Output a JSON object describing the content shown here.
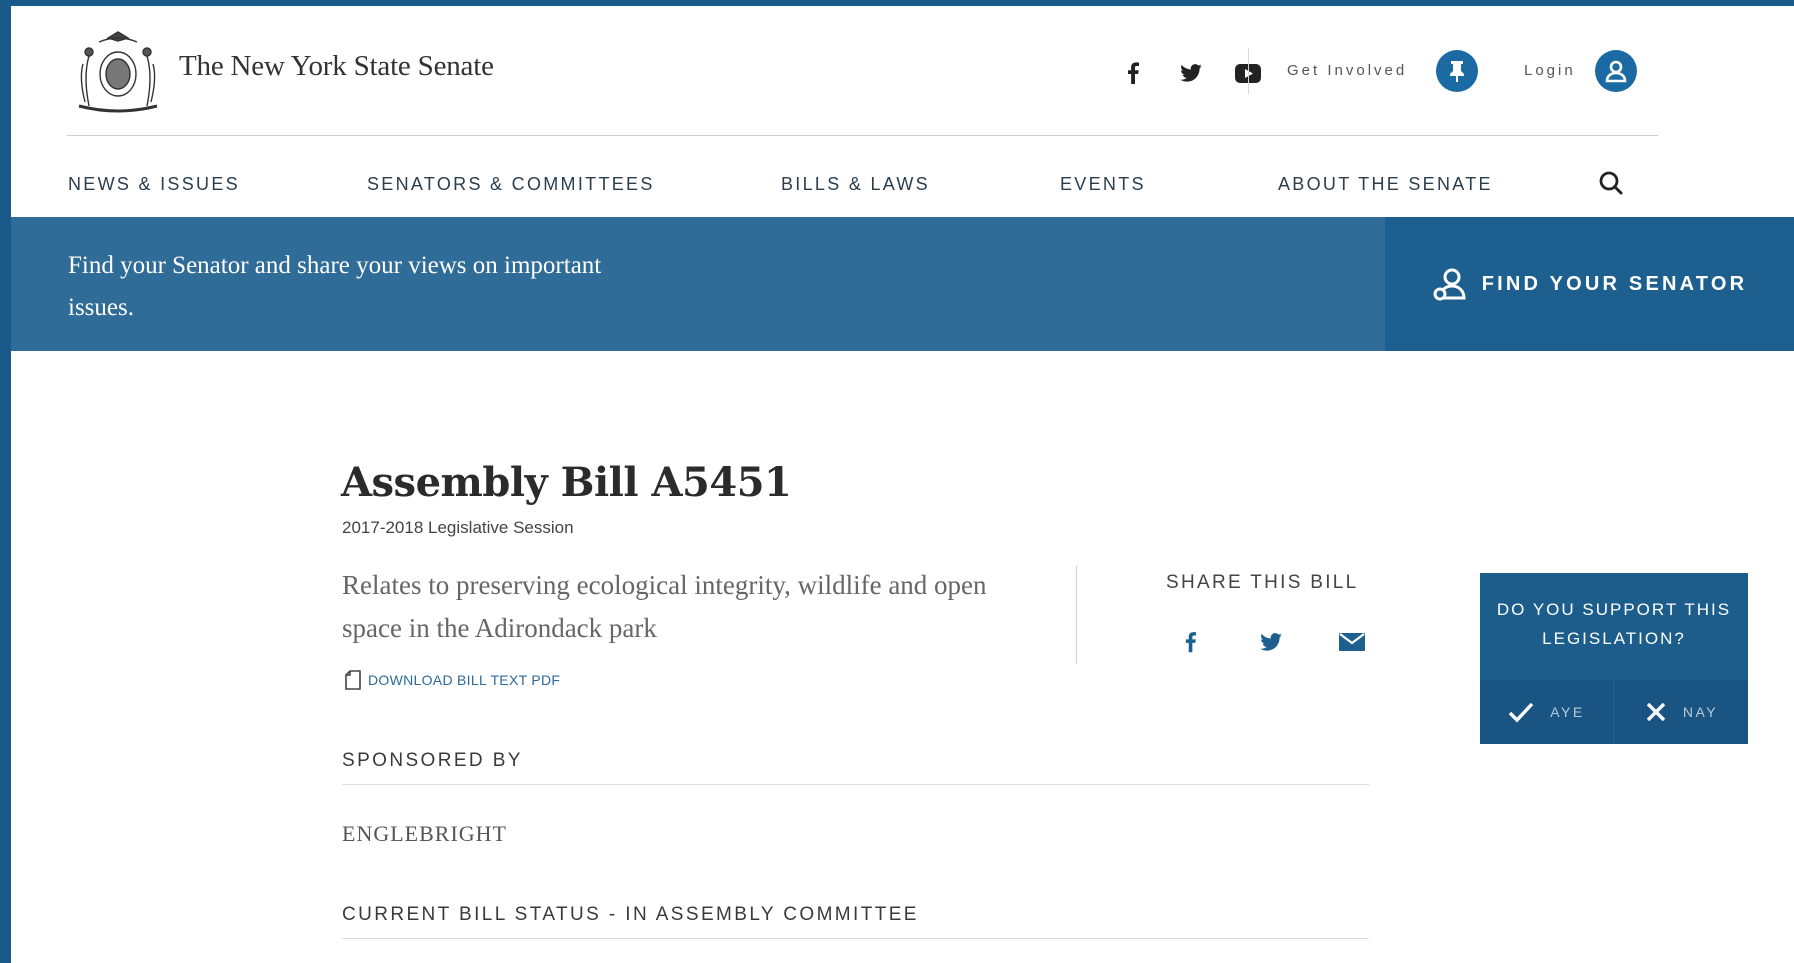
{
  "header": {
    "site_title": "The New York State Senate",
    "social": [
      "facebook-icon",
      "twitter-icon",
      "youtube-icon"
    ],
    "get_involved": "Get Involved",
    "login": "Login"
  },
  "nav": {
    "items": [
      "NEWS & ISSUES",
      "SENATORS & COMMITTEES",
      "BILLS & LAWS",
      "EVENTS",
      "ABOUT THE SENATE"
    ]
  },
  "banner": {
    "text": "Find your Senator and share your views on important issues.",
    "button_label": "FIND YOUR SENATOR"
  },
  "bill": {
    "title": "Assembly Bill A5451",
    "session": "2017-2018 Legislative Session",
    "summary": "Relates to preserving ecological integrity, wildlife and open space in the Adirondack park",
    "download_label": "DOWNLOAD BILL TEXT PDF",
    "share_label": "SHARE THIS BILL",
    "sponsored_by_label": "SPONSORED BY",
    "sponsor": "ENGLEBRIGHT",
    "status_label": "CURRENT BILL STATUS - IN ASSEMBLY COMMITTEE"
  },
  "support": {
    "question": "DO YOU SUPPORT THIS LEGISLATION?",
    "aye": "AYE",
    "nay": "NAY"
  },
  "colors": {
    "brand_blue": "#1c6aa3",
    "banner_blue": "#2f6c98",
    "dark_blue": "#1d5f8f"
  }
}
